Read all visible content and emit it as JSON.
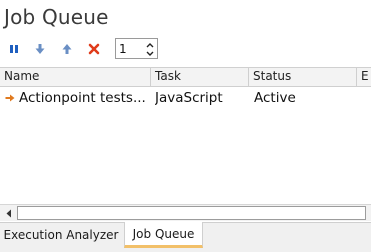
{
  "panel": {
    "title": "Job Queue"
  },
  "toolbar": {
    "buttons": [
      {
        "icon": "pause-icon",
        "color": "#1f5fbf"
      },
      {
        "icon": "move-down-icon",
        "color": "#6a8fc4"
      },
      {
        "icon": "move-up-icon",
        "color": "#6a8fc4"
      },
      {
        "icon": "delete-icon",
        "color": "#e03b1a"
      }
    ],
    "count_value": "1"
  },
  "grid": {
    "columns": [
      "Name",
      "Task",
      "Status",
      "E"
    ],
    "rows": [
      {
        "icon": "arrow-right-icon",
        "name": "Actionpoint tests...",
        "task": "JavaScript",
        "status": "Active"
      }
    ]
  },
  "tabs": [
    {
      "label": "Execution Analyzer",
      "active": false
    },
    {
      "label": "Job Queue",
      "active": true
    }
  ],
  "colors": {
    "accent_tab": "#f2c069",
    "row_icon": "#e07a1f"
  }
}
